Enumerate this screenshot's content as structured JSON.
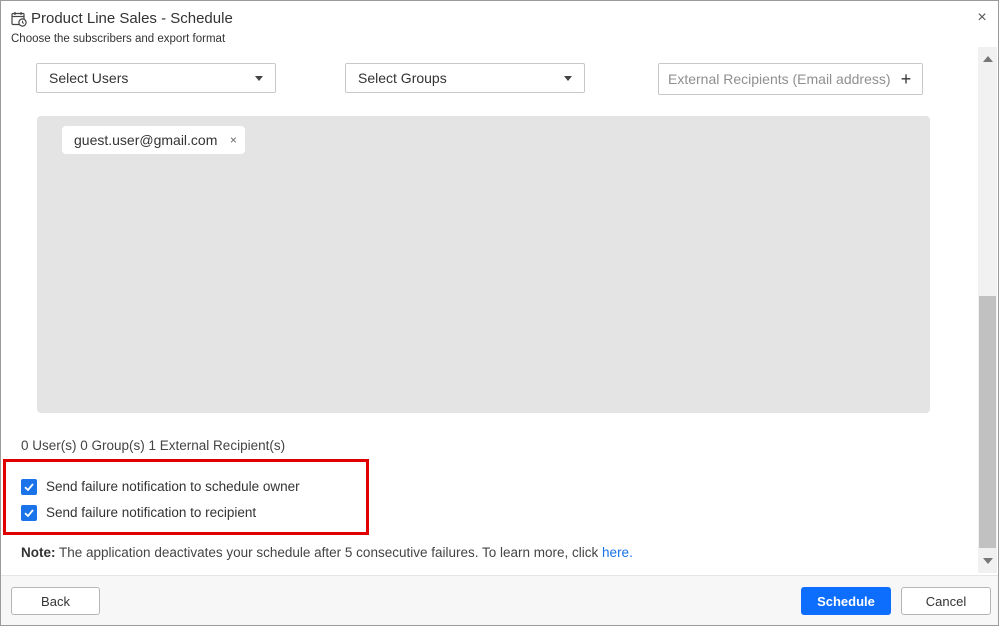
{
  "dialog": {
    "title": "Product Line Sales - Schedule",
    "subtitle": "Choose the subscribers and export format",
    "title_icon": "calendar-clock-icon",
    "close_symbol": "×"
  },
  "selectors": {
    "users_label": "Select Users",
    "groups_label": "Select Groups",
    "external_placeholder": "External Recipients (Email address)",
    "add_symbol": "+"
  },
  "recipients": [
    {
      "email": "guest.user@gmail.com",
      "remove_symbol": "×"
    }
  ],
  "summary": "0 User(s) 0 Group(s) 1 External Recipient(s)",
  "notifications": [
    {
      "label": "Send failure notification to schedule owner",
      "checked": true
    },
    {
      "label": "Send failure notification to recipient",
      "checked": true
    }
  ],
  "note": {
    "prefix": "Note:",
    "text": " The application deactivates your schedule after 5 consecutive failures. To learn more, click ",
    "link": "here."
  },
  "footer": {
    "back": "Back",
    "schedule": "Schedule",
    "cancel": "Cancel"
  },
  "colors": {
    "primary": "#0d6efd",
    "checkbox": "#1a73e8",
    "highlight": "#e00000",
    "recipients_bg": "#e4e4e4"
  }
}
